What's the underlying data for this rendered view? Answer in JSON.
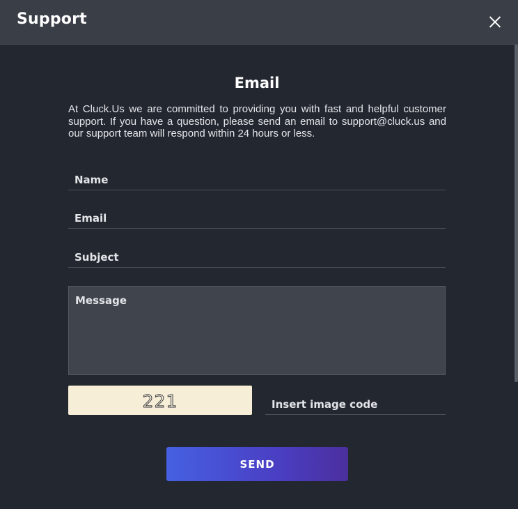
{
  "dialog": {
    "title": "Support",
    "close_icon": "close-icon"
  },
  "section": {
    "title": "Email",
    "intro": "At Cluck.Us we are committed to providing you with fast and helpful customer support. If you have a question, please send an email to support@cluck.us and our support team will respond within 24 hours or less."
  },
  "form": {
    "name": {
      "value": "",
      "placeholder": "Name"
    },
    "email": {
      "value": "",
      "placeholder": "Email"
    },
    "subject": {
      "value": "",
      "placeholder": "Subject"
    },
    "message": {
      "value": "",
      "placeholder": "Message"
    },
    "captcha": {
      "image_code": "221",
      "input_value": "",
      "input_placeholder": "Insert image code"
    },
    "send_label": "SEND"
  },
  "colors": {
    "header_bg": "#3a3f47",
    "body_bg": "#23272f",
    "accent_start": "#4660e2",
    "accent_end": "#4b2f9e",
    "captcha_bg": "#f7eed8"
  }
}
